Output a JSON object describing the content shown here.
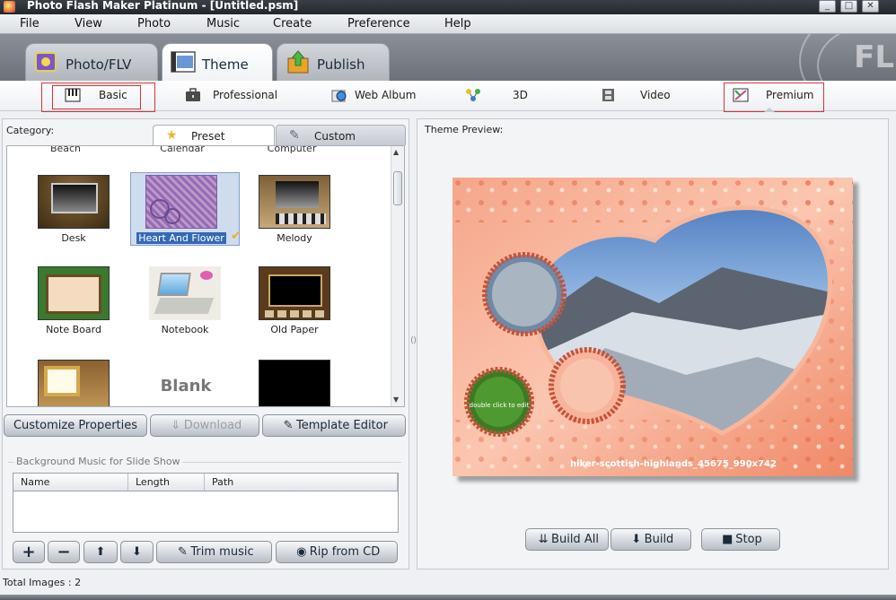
{
  "window": {
    "title": "Photo Flash Maker Platinum - [Untitled.psm]",
    "minimize": "_",
    "maximize": "□",
    "close": "✕"
  },
  "menu": [
    "File",
    "View",
    "Photo",
    "Music",
    "Create",
    "Preference",
    "Help"
  ],
  "main_tabs": [
    {
      "label": "Photo/FLV",
      "icon": "photo-icon"
    },
    {
      "label": "Theme",
      "icon": "theme-icon",
      "active": true
    },
    {
      "label": "Publish",
      "icon": "publish-icon"
    }
  ],
  "theme_tabs": [
    {
      "label": "Basic",
      "icon": "piano-icon"
    },
    {
      "label": "Professional",
      "icon": "briefcase-icon"
    },
    {
      "label": "Web Album",
      "icon": "globe-icon"
    },
    {
      "label": "3D",
      "icon": "molecule-icon"
    },
    {
      "label": "Video",
      "icon": "film-icon"
    },
    {
      "label": "Premium",
      "icon": "premium-icon"
    }
  ],
  "left": {
    "category_label": "Category:",
    "tabs": [
      {
        "label": "Preset",
        "icon": "star-icon"
      },
      {
        "label": "Custom",
        "icon": "wrench-icon"
      }
    ],
    "partial_labels": [
      "Beach",
      "Calendar",
      "Computer"
    ],
    "themes": [
      {
        "label": "Desk"
      },
      {
        "label": "Heart And Flower",
        "selected": true
      },
      {
        "label": "Melody"
      },
      {
        "label": "Note Board"
      },
      {
        "label": "Notebook"
      },
      {
        "label": "Old Paper"
      },
      {
        "label": ""
      },
      {
        "label": ""
      },
      {
        "label": ""
      }
    ],
    "blank_text": "Blank",
    "buttons": {
      "customize": "Customize Properties",
      "download": "Download",
      "template_editor": "Template Editor"
    },
    "music": {
      "title": "Background Music for Slide Show",
      "columns": [
        "Name",
        "Length",
        "Path"
      ],
      "rows": []
    },
    "music_buttons": {
      "add": "+",
      "remove": "−",
      "up": "⬆",
      "down": "⬇",
      "trim": "Trim music",
      "rip": "Rip from CD"
    }
  },
  "right": {
    "preview_label": "Theme Preview:",
    "caption": "hiker-scottish-highlands_45675_990x742",
    "small_circle_text": "double click to edit",
    "buttons": {
      "build_all": "Build All",
      "build": "Build",
      "stop": "Stop"
    }
  },
  "status": {
    "total_images": "Total Images : 2"
  },
  "colors": {
    "selection": "#3569b3",
    "highlight_box": "#d8333a",
    "preview_bg": "#f6b49c"
  }
}
